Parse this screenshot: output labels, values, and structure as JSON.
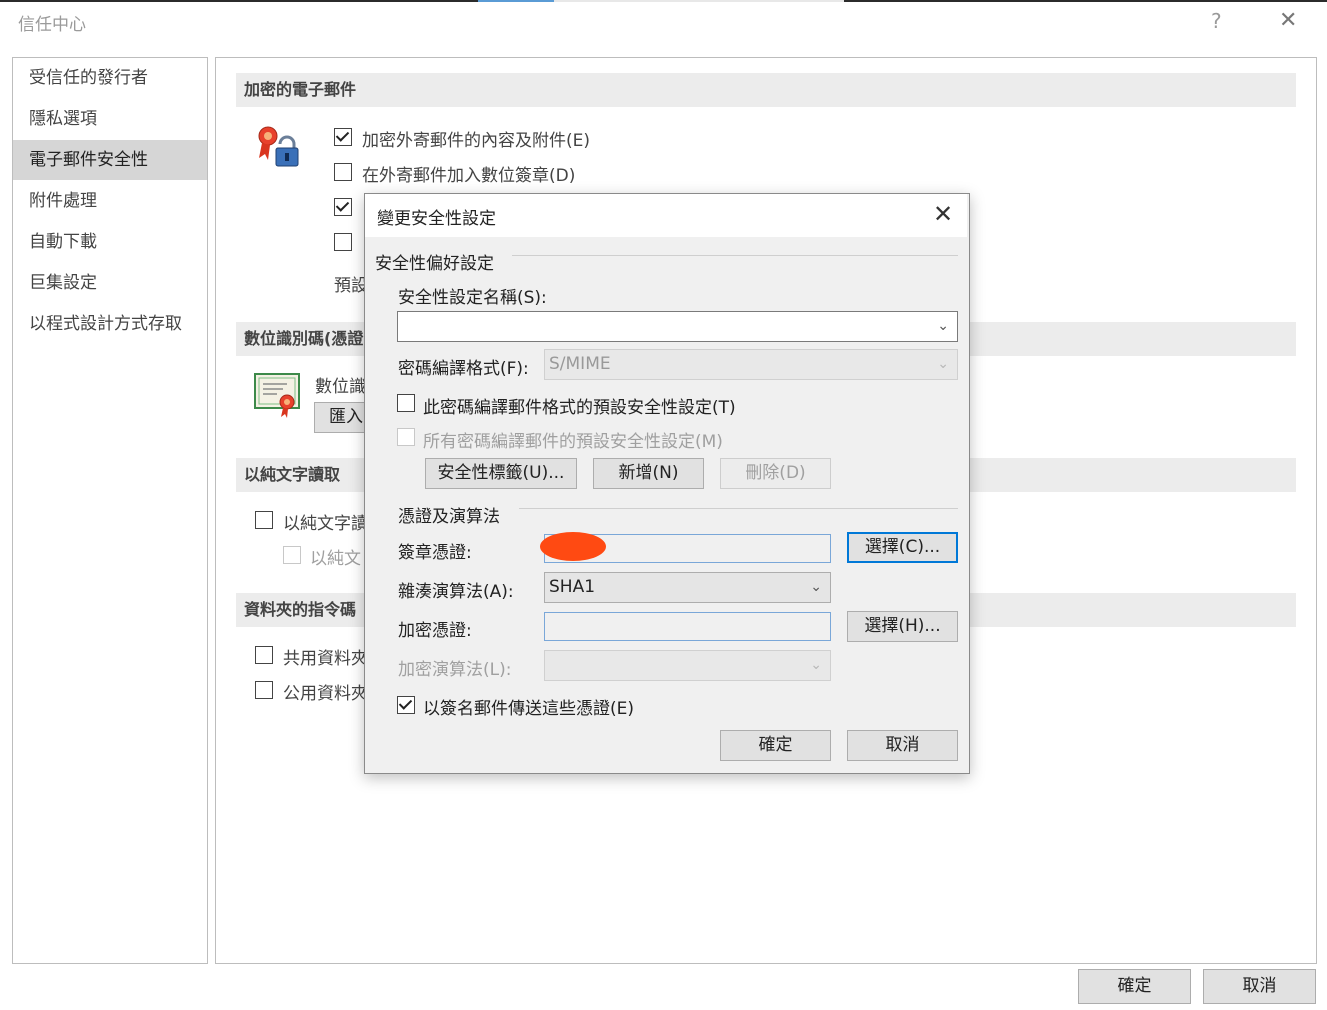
{
  "window": {
    "title": "信任中心",
    "help_glyph": "?",
    "close_glyph": "✕"
  },
  "sidebar": {
    "items": [
      {
        "label": "受信任的發行者"
      },
      {
        "label": "隱私選項"
      },
      {
        "label": "電子郵件安全性",
        "selected": true
      },
      {
        "label": "附件處理"
      },
      {
        "label": "自動下載"
      },
      {
        "label": "巨集設定"
      },
      {
        "label": "以程式設計方式存取"
      }
    ]
  },
  "main": {
    "encrypted_email": {
      "header": "加密的電子郵件",
      "options": [
        {
          "label": "加密外寄郵件的內容及附件(E)",
          "checked": true
        },
        {
          "label": "在外寄郵件加入數位簽章(D)",
          "checked": false
        },
        {
          "label": "",
          "checked": true
        },
        {
          "label": "",
          "checked": false
        }
      ],
      "default_label": "預設"
    },
    "digital_ids": {
      "header": "數位識別碼(憑證)",
      "text": "數位識",
      "import_button": "匯入"
    },
    "plain_text": {
      "header": "以純文字讀取",
      "options": [
        {
          "label": "以純文字讀",
          "checked": false
        },
        {
          "label": "以純文",
          "checked": false,
          "disabled": true
        }
      ]
    },
    "folder_script": {
      "header": "資料夾的指令碼",
      "options": [
        {
          "label": "共用資料夾",
          "checked": false
        },
        {
          "label": "公用資料夾",
          "checked": false
        }
      ]
    }
  },
  "footer": {
    "ok_label": "確定",
    "cancel_label": "取消"
  },
  "dialog": {
    "title": "變更安全性設定",
    "close_glyph": "✕",
    "prefs_group": "安全性偏好設定",
    "settings_name_label": "安全性設定名稱(S):",
    "settings_name_value": "",
    "crypto_format_label": "密碼編譯格式(F):",
    "crypto_format_value": "S/MIME",
    "default_for_format_label": "此密碼編譯郵件格式的預設安全性設定(T)",
    "default_for_all_label": "所有密碼編譯郵件的預設安全性設定(M)",
    "security_labels_button": "安全性標籤(U)...",
    "new_button": "新增(N)",
    "delete_button": "刪除(D)",
    "cert_group": "憑證及演算法",
    "signing_cert_label": "簽章憑證:",
    "choose_signing_button": "選擇(C)...",
    "hash_label": "雜湊演算法(A):",
    "hash_value": "SHA1",
    "encryption_cert_label": "加密憑證:",
    "choose_encryption_button": "選擇(H)...",
    "encryption_algo_label": "加密演算法(L):",
    "encryption_algo_value": "",
    "send_certs_label": "以簽名郵件傳送這些憑證(E)",
    "ok_button": "確定",
    "cancel_button": "取消"
  },
  "colors": {
    "accent": "#0078d7",
    "selected_nav": "#d6d6d6",
    "redaction": "#ff4a12"
  },
  "icons": [
    "certificate-lock-icon",
    "certificate-icon",
    "chevron-down-icon",
    "close-icon",
    "help-icon"
  ]
}
